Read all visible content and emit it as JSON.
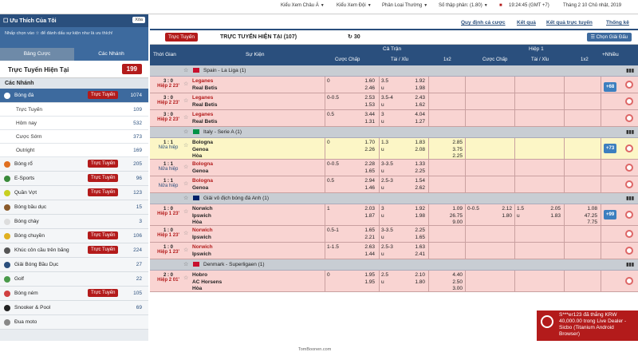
{
  "topbar": {
    "odds_view": "Kiểu Xem Châu Á",
    "team_view": "Kiểu Xem Đội",
    "sort": "Phân Loại Thường",
    "decimal": "Số thập phân: (1.80)",
    "time": "19:24:45 (GMT +7)",
    "date": "Tháng 2 10 Chủ nhật, 2019"
  },
  "sidebar": {
    "fav_title": "Ưu Thích Của Tôi",
    "delete_label": "Xóa",
    "hint": "Nhấp chọn vào ☆ để đánh dấu sự kiện như là ưu thích!",
    "tabs": [
      "Bảng Cược",
      "Các Nhánh"
    ],
    "live_label": "Trực Tuyến Hiện Tại",
    "live_count": "199",
    "branches_title": "Các Nhánh",
    "sports": [
      {
        "name": "Bóng đá",
        "live": "Trực Tuyến",
        "count": "1074",
        "color": "#222"
      },
      {
        "name": "Bóng rổ",
        "live": "Trực Tuyến",
        "count": "205",
        "color": "#e07020"
      },
      {
        "name": "E-Sports",
        "live": "Trực Tuyến",
        "count": "96",
        "color": "#3a8a3a"
      },
      {
        "name": "Quần Vợt",
        "live": "Trực Tuyến",
        "count": "123",
        "color": "#c8d020"
      },
      {
        "name": "Bóng bầu dục",
        "live": "",
        "count": "15",
        "color": "#8a5a2a"
      },
      {
        "name": "Bóng chày",
        "live": "",
        "count": "3",
        "color": "#ddd"
      },
      {
        "name": "Bóng chuyền",
        "live": "Trực Tuyến",
        "count": "106",
        "color": "#e0b020"
      },
      {
        "name": "Khúc côn cầu trên băng",
        "live": "Trực Tuyến",
        "count": "224",
        "color": "#555"
      },
      {
        "name": "Giải Bóng Bầu Dục",
        "live": "",
        "count": "27",
        "color": "#2a4f7d"
      },
      {
        "name": "Golf",
        "live": "",
        "count": "22",
        "color": "#4a9a4a"
      },
      {
        "name": "Bóng ném",
        "live": "Trực Tuyến",
        "count": "105",
        "color": "#d04040"
      },
      {
        "name": "Snooker & Pool",
        "live": "",
        "count": "69",
        "color": "#222"
      },
      {
        "name": "Đua moto",
        "live": "",
        "count": "",
        "color": "#888"
      }
    ],
    "sub_items": [
      {
        "name": "Trực Tuyến",
        "count": "109"
      },
      {
        "name": "Hôm nay",
        "count": "532"
      },
      {
        "name": "Cược Sớm",
        "count": "373"
      },
      {
        "name": "Outright",
        "count": "169"
      }
    ]
  },
  "main": {
    "links": [
      "Quy định cá cược",
      "Kết quả",
      "Kết quả trực tuyến",
      "Thống kê"
    ],
    "live_badge": "Trực Tuyến",
    "page_title": "TRỰC TUYẾN HIỆN TẠI (107)",
    "refresh": "30",
    "select_league": "Chọn Giải Đấu",
    "col": {
      "time": "Thời Gian",
      "event": "Sự Kiện",
      "full": "Cả Trận",
      "half": "Hiệp 1",
      "more": "+Nhiều",
      "handicap": "Cược Chấp",
      "ou": "Tài / Xỉu",
      "x12": "1x2",
      "handicap2": "Cược Chấp",
      "ou2": "Tài / Xỉu",
      "x12b": "1x2"
    },
    "leagues": [
      {
        "name": "Spain - La Liga (1)",
        "flag": "#c8102e"
      },
      {
        "name": "Italy - Serie A (1)",
        "flag": "#009246"
      },
      {
        "name": "Giải vô địch bóng đá Anh (1)",
        "flag": "#012169"
      },
      {
        "name": "Denmark - Superligaen (1)",
        "flag": "#c8102e"
      }
    ],
    "matches": [
      {
        "score": "3 : 0",
        "period": "Hiệp 2 23'",
        "home": "Leganes",
        "away": "Real Betis",
        "draw": "",
        "hcp": "0",
        "h1": "1.60",
        "h2": "2.46",
        "ou": "3.5",
        "ou_u": "u",
        "o1": "1.92",
        "o2": "1.98",
        "x1": "",
        "x2": "",
        "x3": "",
        "hh": "",
        "hh1": "",
        "hh2": "",
        "hou": "",
        "hou_u": "",
        "ho1": "",
        "ho2": "",
        "hx1": "",
        "hx2": "",
        "hx3": "",
        "more": "+68"
      },
      {
        "score": "3 : 0",
        "period": "Hiệp 2 23'",
        "home": "Leganes",
        "away": "Real Betis",
        "draw": "",
        "hcp": "0-0.5",
        "h1": "2.53",
        "h2": "1.53",
        "ou": "3.5-4",
        "ou_u": "u",
        "o1": "2.43",
        "o2": "1.62"
      },
      {
        "score": "3 : 0",
        "period": "Hiệp 2 23'",
        "home": "Leganes",
        "away": "Real Betis",
        "draw": "",
        "hcp": "0.5",
        "h1": "3.44",
        "h2": "1.31",
        "ou": "3",
        "ou_u": "u",
        "o1": "4.04",
        "o2": "1.27"
      },
      {
        "score": "1 : 1",
        "period": "Nửa hiệp",
        "home": "Bologna",
        "away": "Genoa",
        "draw": "Hòa",
        "hcp": "0",
        "h1": "1.70",
        "h2": "2.26",
        "ou": "1.3",
        "ou_u": "u",
        "o1": "1.83",
        "o2": "2.08",
        "x1": "2.85",
        "x2": "3.75",
        "x3": "2.25",
        "more": "+73"
      },
      {
        "score": "1 : 1",
        "period": "Nửa hiệp",
        "home": "Bologna",
        "away": "Genoa",
        "draw": "",
        "hcp": "0-0.5",
        "h1": "2.28",
        "h2": "1.65",
        "ou": "3-3.5",
        "ou_u": "u",
        "o1": "1.33",
        "o2": "2.25"
      },
      {
        "score": "1 : 1",
        "period": "Nửa hiệp",
        "home": "Bologna",
        "away": "Genoa",
        "draw": "",
        "hcp": "0.5",
        "h1": "2.94",
        "h2": "1.46",
        "ou": "2.5-3",
        "ou_u": "u",
        "o1": "1.54",
        "o2": "2.62"
      },
      {
        "score": "1 : 0",
        "period": "Hiệp 1 23'",
        "home": "Norwich",
        "away": "Ipswich",
        "draw": "Hòa",
        "hcp": "1",
        "h1": "2.03",
        "h2": "1.87",
        "ou": "3",
        "ou_u": "u",
        "o1": "1.92",
        "o2": "1.98",
        "x1": "1.09",
        "x2": "26.75",
        "x3": "9.00",
        "hh": "0-0.5",
        "hh1": "2.12",
        "hh2": "1.80",
        "hou": "1.5",
        "hou_u": "u",
        "ho1": "2.05",
        "ho2": "1.83",
        "hx1": "1.08",
        "hx2": "47.25",
        "hx3": "7.75",
        "more": "+99"
      },
      {
        "score": "1 : 0",
        "period": "Hiệp 1 23'",
        "home": "Norwich",
        "away": "Ipswich",
        "draw": "",
        "hcp": "0.5-1",
        "h1": "1.65",
        "h2": "2.21",
        "ou": "3-3.5",
        "ou_u": "u",
        "o1": "2.25",
        "o2": "1.65"
      },
      {
        "score": "1 : 0",
        "period": "Hiệp 1 23'",
        "home": "Norwich",
        "away": "Ipswich",
        "draw": "",
        "hcp": "1-1.5",
        "h1": "2.63",
        "h2": "1.44",
        "ou": "2.5-3",
        "ou_u": "u",
        "o1": "1.63",
        "o2": "2.41"
      },
      {
        "score": "2 : 0",
        "period": "Hiệp 2 01'",
        "home": "Hobro",
        "away": "AC Horsens",
        "draw": "Hòa",
        "hcp": "0",
        "h1": "1.95",
        "h2": "1.95",
        "ou": "2.5",
        "ou_u": "u",
        "o1": "2.10",
        "o2": "1.80",
        "x1": "4.40",
        "x2": "2.50",
        "x3": "3.00"
      }
    ],
    "watermark": "TomBoonen.com"
  },
  "toast": {
    "text": "S***er123 đã thắng KRW 40,000.00 trong Live Dealer - Sicbo (Titanium Android Browser)"
  }
}
